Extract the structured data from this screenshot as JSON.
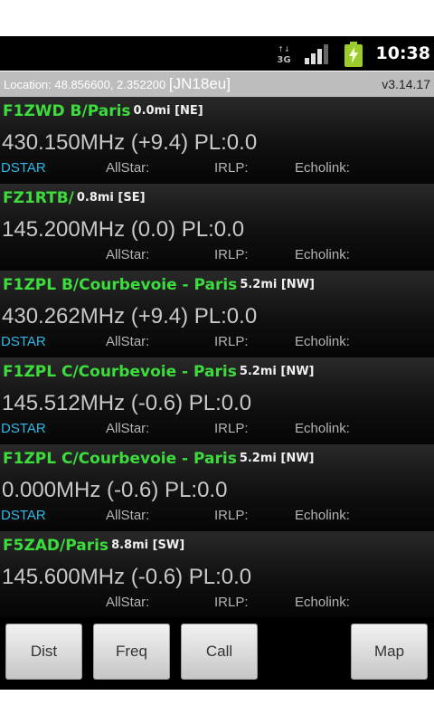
{
  "status_bar": {
    "network_label_top": "↑↓",
    "network_label": "3G",
    "signal_icon": "signal-bars-icon",
    "battery_icon": "battery-charging-icon",
    "time": "10:38"
  },
  "location_bar": {
    "location": "Location: 48.856600, 2.352200",
    "grid": "[JN18eu]",
    "version": "v3.14.17"
  },
  "labels": {
    "allstar": "AllStar:",
    "irlp": "IRLP:",
    "echolink": "Echolink:"
  },
  "repeaters": [
    {
      "call": "F1ZWD  B/Paris",
      "distance": "0.0mi [NE]",
      "frequency": "430.150MHz (+9.4) PL:0.0",
      "mode": "DSTAR"
    },
    {
      "call": "FZ1RTB/",
      "distance": "0.8mi [SE]",
      "frequency": "145.200MHz (0.0) PL:0.0",
      "mode": ""
    },
    {
      "call": "F1ZPL  B/Courbevoie - Paris",
      "distance": "5.2mi [NW]",
      "frequency": "430.262MHz (+9.4) PL:0.0",
      "mode": "DSTAR"
    },
    {
      "call": "F1ZPL  C/Courbevoie - Paris",
      "distance": "5.2mi [NW]",
      "frequency": "145.512MHz (-0.6) PL:0.0",
      "mode": "DSTAR"
    },
    {
      "call": "F1ZPL  C/Courbevoie - Paris",
      "distance": "5.2mi [NW]",
      "frequency": "0.000MHz (-0.6) PL:0.0",
      "mode": "DSTAR"
    },
    {
      "call": "F5ZAD/Paris",
      "distance": "8.8mi [SW]",
      "frequency": "145.600MHz (-0.6) PL:0.0",
      "mode": ""
    }
  ],
  "buttons": {
    "dist": "Dist",
    "freq": "Freq",
    "call": "Call",
    "map": "Map"
  },
  "colors": {
    "callsign": "#3ddc3d",
    "mode": "#2fb8e8",
    "location_bar": "#bdbdbd"
  }
}
